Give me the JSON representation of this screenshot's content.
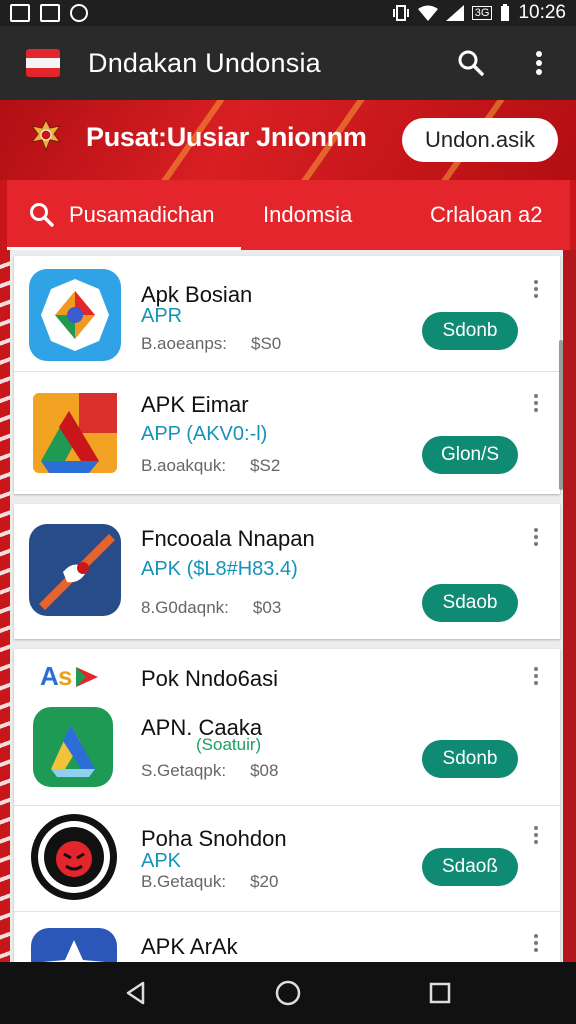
{
  "status_bar": {
    "time": "10:26",
    "small_label": "3G"
  },
  "app_bar": {
    "title": "Dndakan Undonsia"
  },
  "banner": {
    "title": "Pusat:Uusiar Jnionnm",
    "pill": "Undon.asik"
  },
  "tabs": [
    {
      "label": "Pusamadichan"
    },
    {
      "label": "Indomsia"
    },
    {
      "label": "Crlaloan a2"
    }
  ],
  "apps": [
    {
      "name": "Apk Bosian",
      "sub": "APR",
      "meta": "B.aoeanps:",
      "price": "$S0",
      "button": "Sdonb"
    },
    {
      "name": "APK Eimar",
      "sub": "APP (AKV0:-l)",
      "meta": "B.aoakquk:",
      "price": "$S2",
      "button": "Glon/S"
    },
    {
      "name": "Fncooala Nnapan",
      "sub": "APK ($L8#H83.4)",
      "meta": "8.G0daqnk:",
      "price": "$03",
      "button": "Sdaob"
    },
    {
      "header_logo": "AsD",
      "header_title": "Pok Nndo6asi",
      "name": "APN. Caaka",
      "sub": "(Soatuir)",
      "meta": "S.Getaqpk:",
      "price": "$08",
      "button": "Sdonb"
    },
    {
      "name": "Poha Snohdon",
      "sub": "APK",
      "meta": "B.Getaquk:",
      "price": "$20",
      "button": "Sdaoß"
    },
    {
      "name": "APK ArAk"
    }
  ],
  "colors": {
    "primary_red": "#e4252b",
    "install_green": "#0f8a73",
    "link_blue": "#1593b8"
  }
}
